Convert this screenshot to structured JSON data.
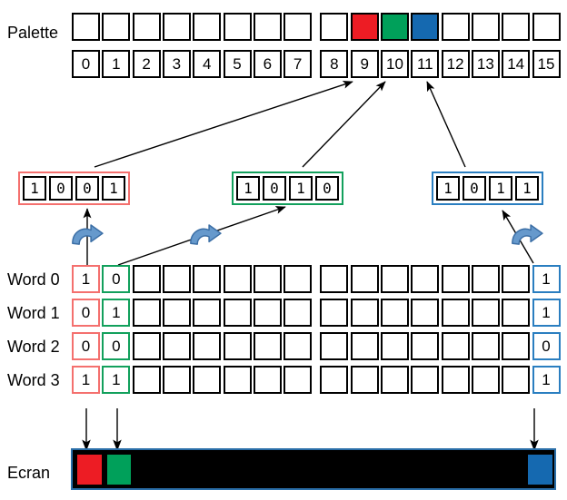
{
  "diagram": {
    "title_labels": {
      "palette": "Palette",
      "ecran": "Ecran"
    },
    "colors": {
      "red": "#ED1C24",
      "green": "#00A05A",
      "blue": "#1569B0",
      "red_border": "#f4706e",
      "green_border": "#12a05c",
      "blue_border": "#2a7ec0",
      "ecran_background": "#000000",
      "ecran_border": "#2a6ea8",
      "curved_arrow_fill": "#6699CC",
      "curved_arrow_stroke": "#3B6EA5",
      "arrow_stroke": "#000000"
    }
  },
  "palette": {
    "label": "Palette",
    "indices": [
      "0",
      "1",
      "2",
      "3",
      "4",
      "5",
      "6",
      "7",
      "8",
      "9",
      "10",
      "11",
      "12",
      "13",
      "14",
      "15"
    ],
    "swatches": [
      {
        "index": "0",
        "color": null
      },
      {
        "index": "1",
        "color": null
      },
      {
        "index": "2",
        "color": null
      },
      {
        "index": "3",
        "color": null
      },
      {
        "index": "4",
        "color": null
      },
      {
        "index": "5",
        "color": null
      },
      {
        "index": "6",
        "color": null
      },
      {
        "index": "7",
        "color": null
      },
      {
        "index": "8",
        "color": null
      },
      {
        "index": "9",
        "color": "#ED1C24"
      },
      {
        "index": "10",
        "color": "#00A05A"
      },
      {
        "index": "11",
        "color": "#1569B0"
      },
      {
        "index": "12",
        "color": null
      },
      {
        "index": "13",
        "color": null
      },
      {
        "index": "14",
        "color": null
      },
      {
        "index": "15",
        "color": null
      }
    ]
  },
  "bit_groups": [
    {
      "name": "red-group",
      "accent": "red",
      "bits": [
        "1",
        "0",
        "0",
        "1"
      ],
      "value": "9"
    },
    {
      "name": "green-group",
      "accent": "green",
      "bits": [
        "1",
        "0",
        "1",
        "0"
      ],
      "value": "10"
    },
    {
      "name": "blue-group",
      "accent": "blue",
      "bits": [
        "1",
        "0",
        "1",
        "1"
      ],
      "value": "11"
    }
  ],
  "words": {
    "rows": [
      {
        "label": "Word 0",
        "bits": [
          "1",
          "0",
          "",
          "",
          "",
          "",
          "",
          "",
          "",
          "",
          "",
          "",
          "",
          "",
          "",
          "1"
        ]
      },
      {
        "label": "Word 1",
        "bits": [
          "0",
          "1",
          "",
          "",
          "",
          "",
          "",
          "",
          "",
          "",
          "",
          "",
          "",
          "",
          "",
          "1"
        ]
      },
      {
        "label": "Word 2",
        "bits": [
          "0",
          "0",
          "",
          "",
          "",
          "",
          "",
          "",
          "",
          "",
          "",
          "",
          "",
          "",
          "",
          "0"
        ]
      },
      {
        "label": "Word 3",
        "bits": [
          "1",
          "1",
          "",
          "",
          "",
          "",
          "",
          "",
          "",
          "",
          "",
          "",
          "",
          "",
          "",
          "1"
        ]
      }
    ],
    "accent_columns": {
      "0": "red",
      "1": "green",
      "15": "blue"
    }
  },
  "ecran": {
    "label": "Ecran",
    "pixels": [
      {
        "position": 0,
        "color": "#ED1C24"
      },
      {
        "position": 1,
        "color": "#00A05A"
      },
      {
        "position": 15,
        "color": "#1569B0"
      }
    ]
  }
}
